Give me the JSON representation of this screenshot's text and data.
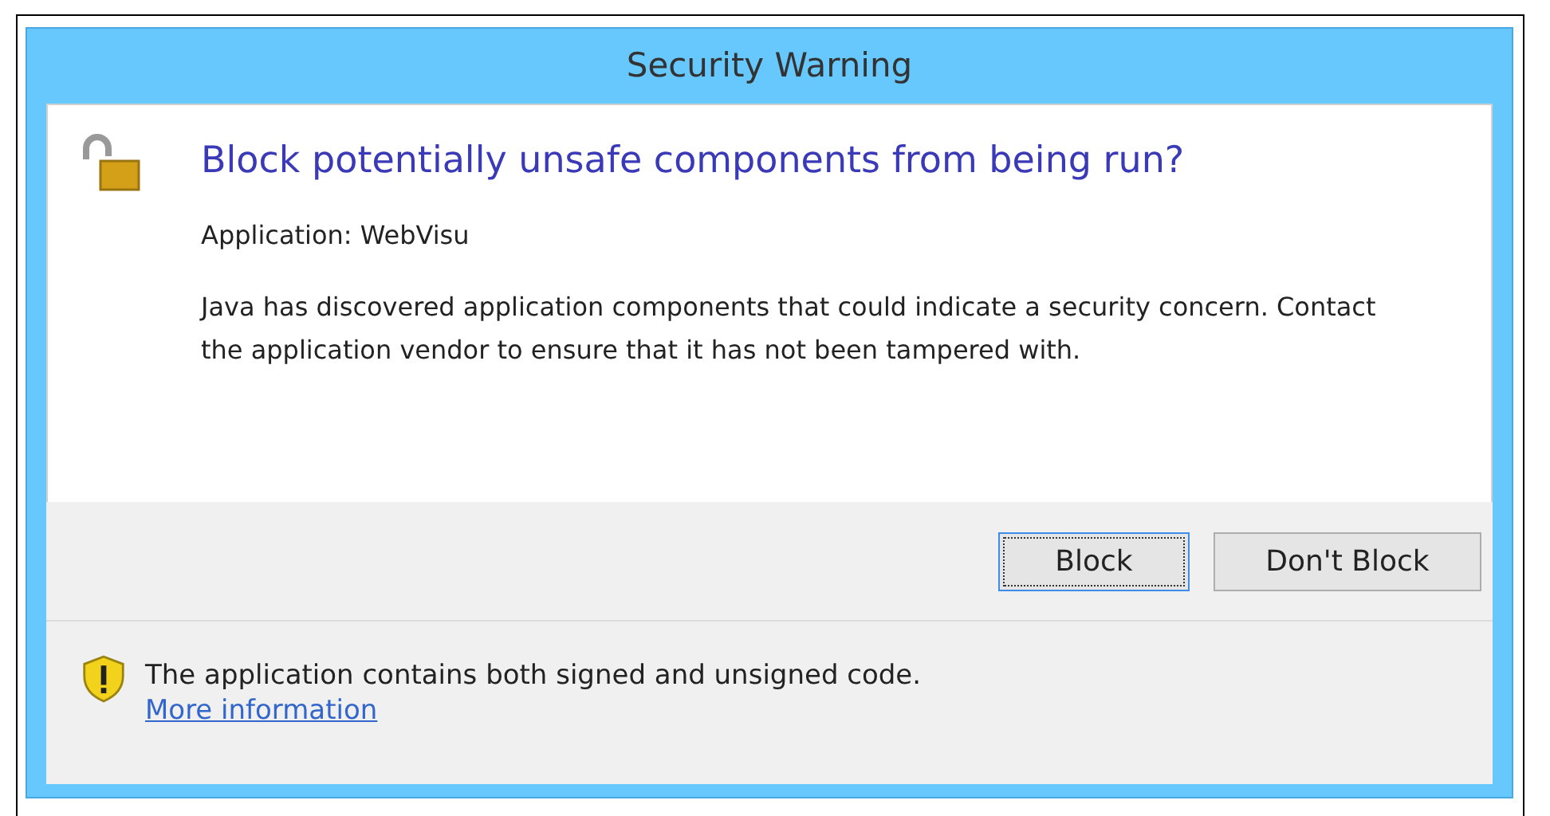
{
  "window": {
    "title": "Security Warning"
  },
  "heading": "Block potentially unsafe components from being run?",
  "application": "Application: WebVisu",
  "message": "Java has discovered application components that could indicate a security concern. Contact the application vendor to ensure that it has not been tampered with.",
  "buttons": [
    {
      "label": "Block",
      "focused": true
    },
    {
      "label": "Don't Block",
      "focused": false
    }
  ],
  "footer": {
    "text": "The application contains both signed and unsigned code.",
    "link": "More information"
  }
}
